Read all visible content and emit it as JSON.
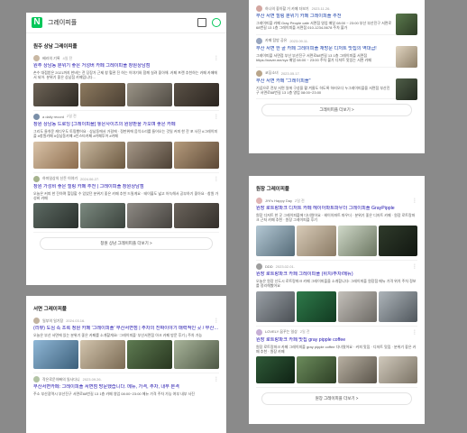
{
  "panel1": {
    "search_query": "그레이피플",
    "section_title": "원주 상남 그레이피플",
    "posts": [
      {
        "author": "베러의 기록",
        "date": "4일 전",
        "title": "원주 상남동 분위기 좋은 거성버 카페 그레이피플 창원상남점",
        "snippet": "손수 대접받은 2021까지 한바는 전 당장가 근제 창 혈관 진 하는 이야기와 함께 실려 좋아해. 카페 프랜 추천하는 카페 카페에서 되어. 분위기 좋은 상남점 카페입니다..."
      },
      {
        "author": "a daily record",
        "date": "2일 전",
        "title": "창원 상남동 드로잉 [그레이피플] 놓은사이즈의 원양판을 가오며 좋은 카페",
        "snippet": "그리도 들쉬운 캐디우도 토핑했어요 · 상남동에서 거걸에 · 정판위에 음악소리를 들어오는 것일 커피 한 잔 포 사진 #그레이피플 #창원카페 #상남동카페 #인스타카페 #카페투어 #카페"
      },
      {
        "author": "하마일상의 신돈 이야기",
        "date": "2024.06.27.",
        "title": "창원 가성비 좋은 힐링 카페 추천 | 그레이피플 창원상남점",
        "snippet": "오늘은 커피 한 잔하며 힐링할 수 있었던 분위기 좋은 카페 추천 드릴게요 · 테이블도 넓고 아늑해서 공부하기 좋아요 · 창원 가성비 카페"
      }
    ],
    "more_label": "창원 상남 그레이피플 더보기 >"
  },
  "panel2": {
    "posts": [
      {
        "author": "하나의 좋아할 거 카페 더보기",
        "date": "2023.11.26.",
        "title": "부산 서면 힐링 분위기 카페 그레이피플 추천",
        "snippet": "그레이피플 카페 Gray People cafe 서면점 영업 매일 08:00 ~ 23:00 부산 부산진구 서면로68번길 13 1층 그레이피플 서면점 010-1234-5678 주차 불가"
      },
      {
        "author": "카페 탐방 공유",
        "date": "2023.09.11.",
        "title": "부산 서면 한 골 카페 그레이피플 재방문 디저트 맛집의 역대급!",
        "snippet": "그레이피플 서면점 부산 부산진구 서면로68번길 13 1층 그레이피플 서면점 https://naver.me/xyz 매일 08:00 ~ 23:00 주차 불가 디저트 맛있는 서면 카페"
      },
      {
        "author": "코딩소녀",
        "date": "2023.05.17.",
        "title": "부산 서면 카페 \"그레이피플\"",
        "snippet": "기념으로 전부 서면 일에 구성을 활 겨울도 하도록 하러오다 누그레이피플을 서면점 부산진구 서면로68번길 13 1층 영업 08:00~23:00"
      }
    ],
    "more_label": "그레이피플 더보기 >"
  },
  "panel3": {
    "section_title": "서면 그레이피플",
    "posts": [
      {
        "author": "일부의 일기장",
        "date": "2024.03.16.",
        "title": "(리뷰) 도심 속 초록 정원 카페 '그레이피플' 부산서면점 | 주차의 진짜이야기 매력적인 곳 / 부산 서면...",
        "snippet": "오늘은 부산 서면에 있는 분위기 좋은 카페를 소개할게요! '그레이피플' 부산서면점 아크 카페 방문 후기 | 주차 가능"
      },
      {
        "author": "작은로운아빠의 일사다니",
        "date": "2023.09.26.",
        "title": "부산서면카페: 그레이피플 서면점 방문했습니다. 메뉴, 가격, 주차, 내부 본격",
        "snippet": "주소 부산광역시 부산진구 서면로68번길 13 1층 카페 영업 08:00~23:00 메뉴 가격 주차 가능 여부 내부 사진"
      }
    ]
  },
  "panel4": {
    "section_title": "원장 그레이피플",
    "posts": [
      {
        "author": "JiYi's Happy Day",
        "date": "2일 전",
        "title": "원장 로트랑파크 디저트 카페 헤이아파트파우더 그레이피플 GrayPipple",
        "snippet": "원장 디저트 한 곳 그레이피플에 다녀왔어요 · 헤이아파트 파우더 · 분위기 좋은 디저트 카페 · 원장 로트랑파크 근처 카페 추천 · 원장 그레이피플 후기"
      },
      {
        "author": "DDD",
        "date": "2023.02.01.",
        "title": "원장 로트랑파크 카페 그레이피플 (위치/주차/메뉴)",
        "snippet": "오늘은 원장 신도시 로트랑파크 카페 그레이피플을 소개합니다! 그레이피플 원장점 메뉴 가격 위치 주차 정보를 정리해봤어요"
      },
      {
        "author": "LOVELY 꿈꾸는 일상",
        "date": "2일 전",
        "title": "원장 로트랑파크 카페 맛집 gray pipple coffee",
        "snippet": "원장 로트랑파크 카페 그레이피플 gray pipple coffee 다녀왔어요 · 커피 맛집 · 디저트 맛집 · 분위기 좋은 카페 추천 · 원장 카페"
      }
    ],
    "more_label": "원장 그레이피플 더보기 >"
  },
  "colors": {
    "naver_green": "#03c75a",
    "link_blue": "#1a0dab",
    "background": "#8a8a8a"
  }
}
